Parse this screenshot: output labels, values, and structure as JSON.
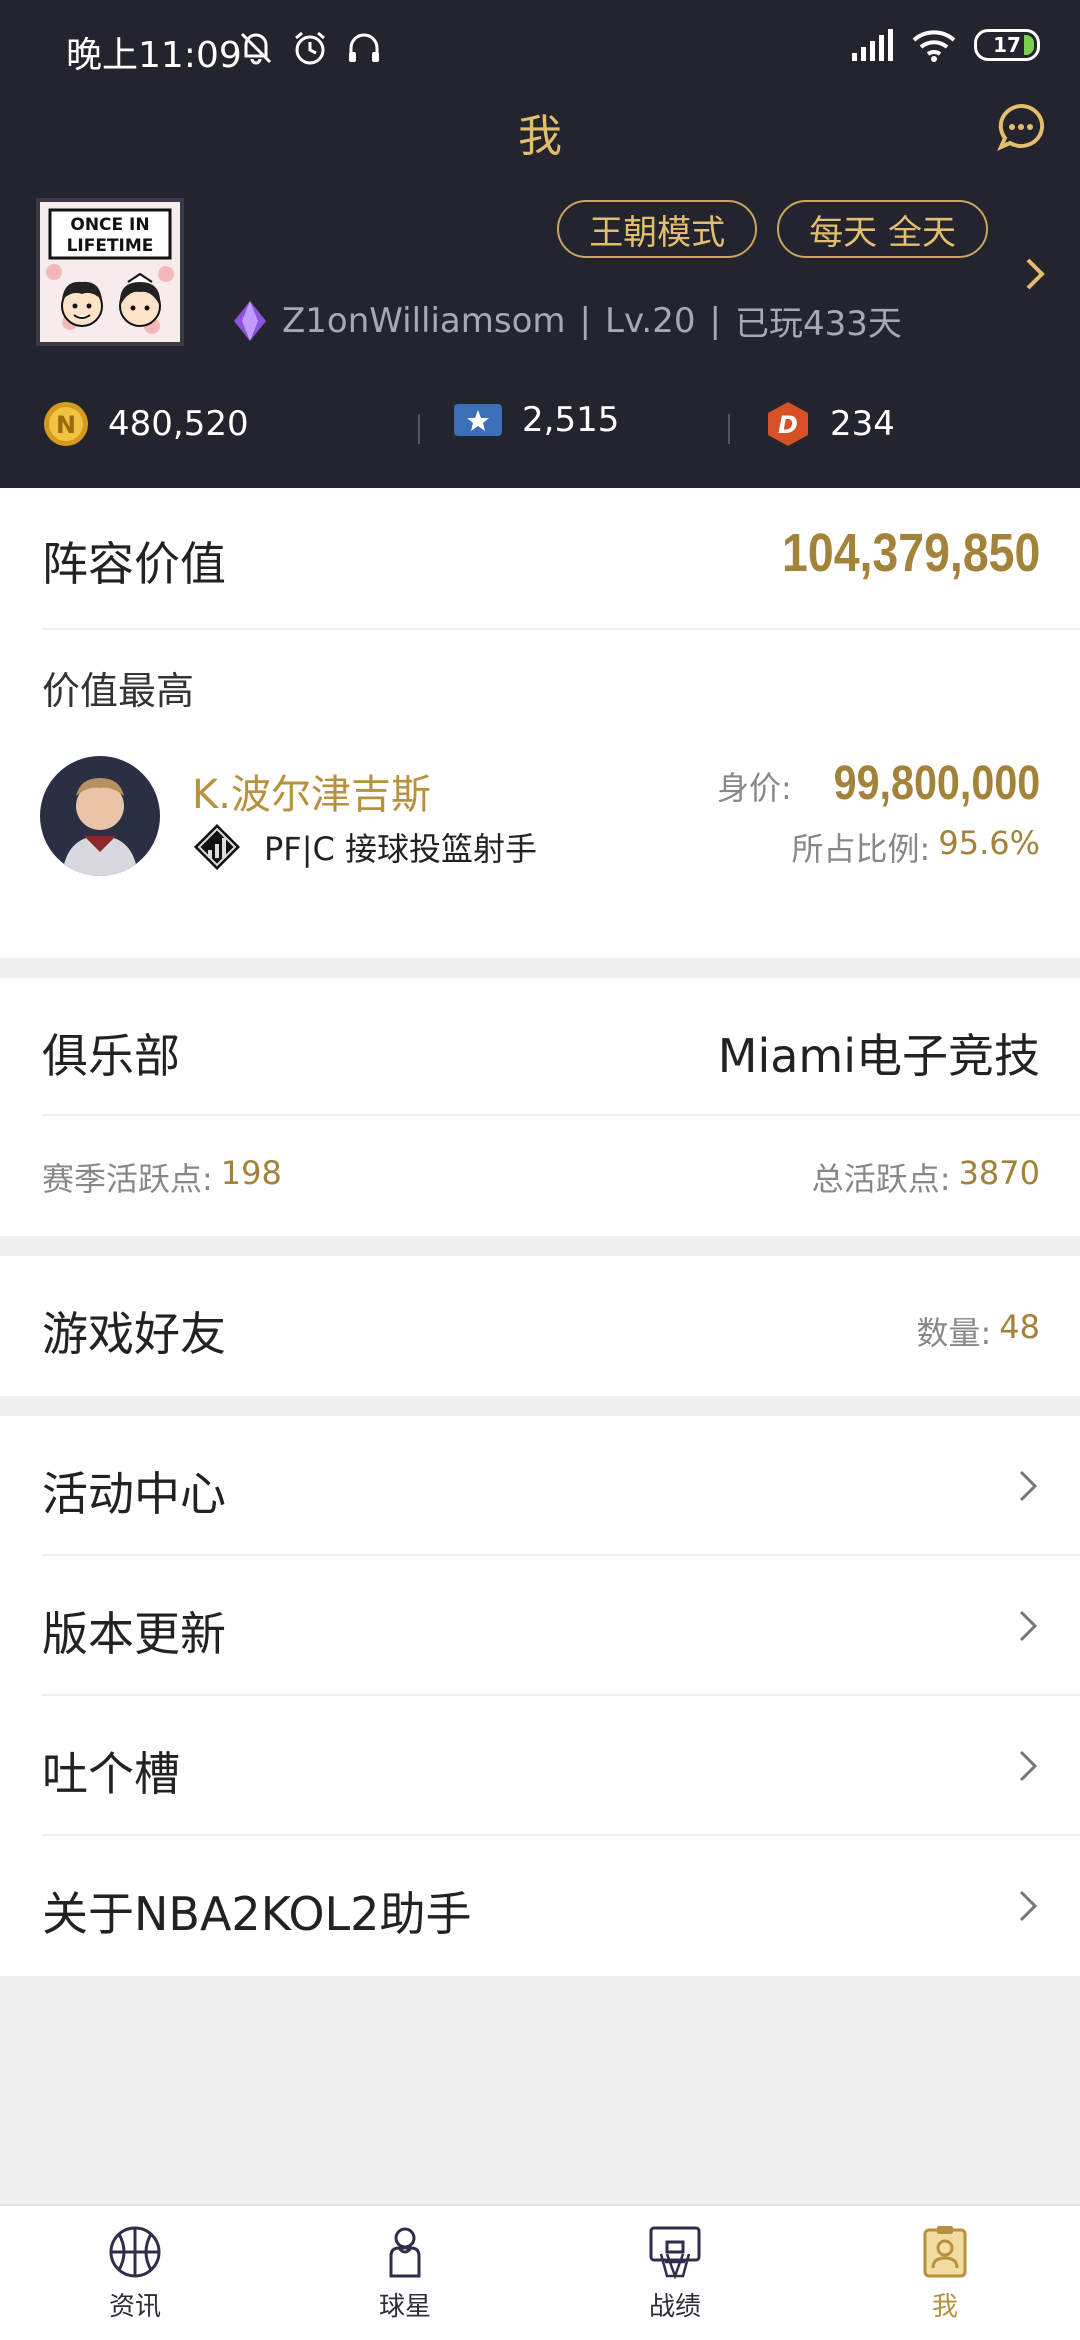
{
  "status_bar": {
    "time": "晚上11:09",
    "battery": "17",
    "icons": [
      "mute-bell-icon",
      "alarm-icon",
      "headset-icon",
      "signal-icon",
      "wifi-icon",
      "battery-icon"
    ]
  },
  "header": {
    "title": "我",
    "badges": [
      "王朝模式",
      "每天 全天"
    ],
    "username": "Z1onWilliamsom",
    "separator": "|",
    "level": "Lv.20",
    "days_played": "已玩433天",
    "avatar_text": [
      "ONCE IN",
      "LIFETIME"
    ]
  },
  "currencies": [
    {
      "icon": "gold-coin-icon",
      "value": "480,520"
    },
    {
      "icon": "star-ticket-icon",
      "value": "2,515"
    },
    {
      "icon": "d-token-icon",
      "value": "234"
    }
  ],
  "lineup": {
    "label": "阵容价值",
    "value": "104,379,850",
    "top_label": "价值最高",
    "player": {
      "name": "K.波尔津吉斯",
      "position": "PF|C 接球投篮射手",
      "price_label": "身价:",
      "price": "99,800,000",
      "ratio_label": "所占比例:",
      "ratio": "95.6%"
    }
  },
  "club": {
    "label": "俱乐部",
    "name": "Miami电子竞技",
    "season_label": "赛季活跃点:",
    "season_value": "198",
    "total_label": "总活跃点:",
    "total_value": "3870"
  },
  "friends": {
    "label": "游戏好友",
    "count_label": "数量:",
    "count": "48"
  },
  "menu": [
    {
      "label": "活动中心"
    },
    {
      "label": "版本更新"
    },
    {
      "label": "吐个槽"
    },
    {
      "label": "关于NBA2KOL2助手"
    }
  ],
  "tabs": [
    {
      "label": "资讯"
    },
    {
      "label": "球星"
    },
    {
      "label": "战绩"
    },
    {
      "label": "我"
    }
  ],
  "colors": {
    "header_bg": "#24242e",
    "gold": "#a3823a",
    "accent": "#e2bf6e",
    "bg": "#f0f0f0"
  }
}
